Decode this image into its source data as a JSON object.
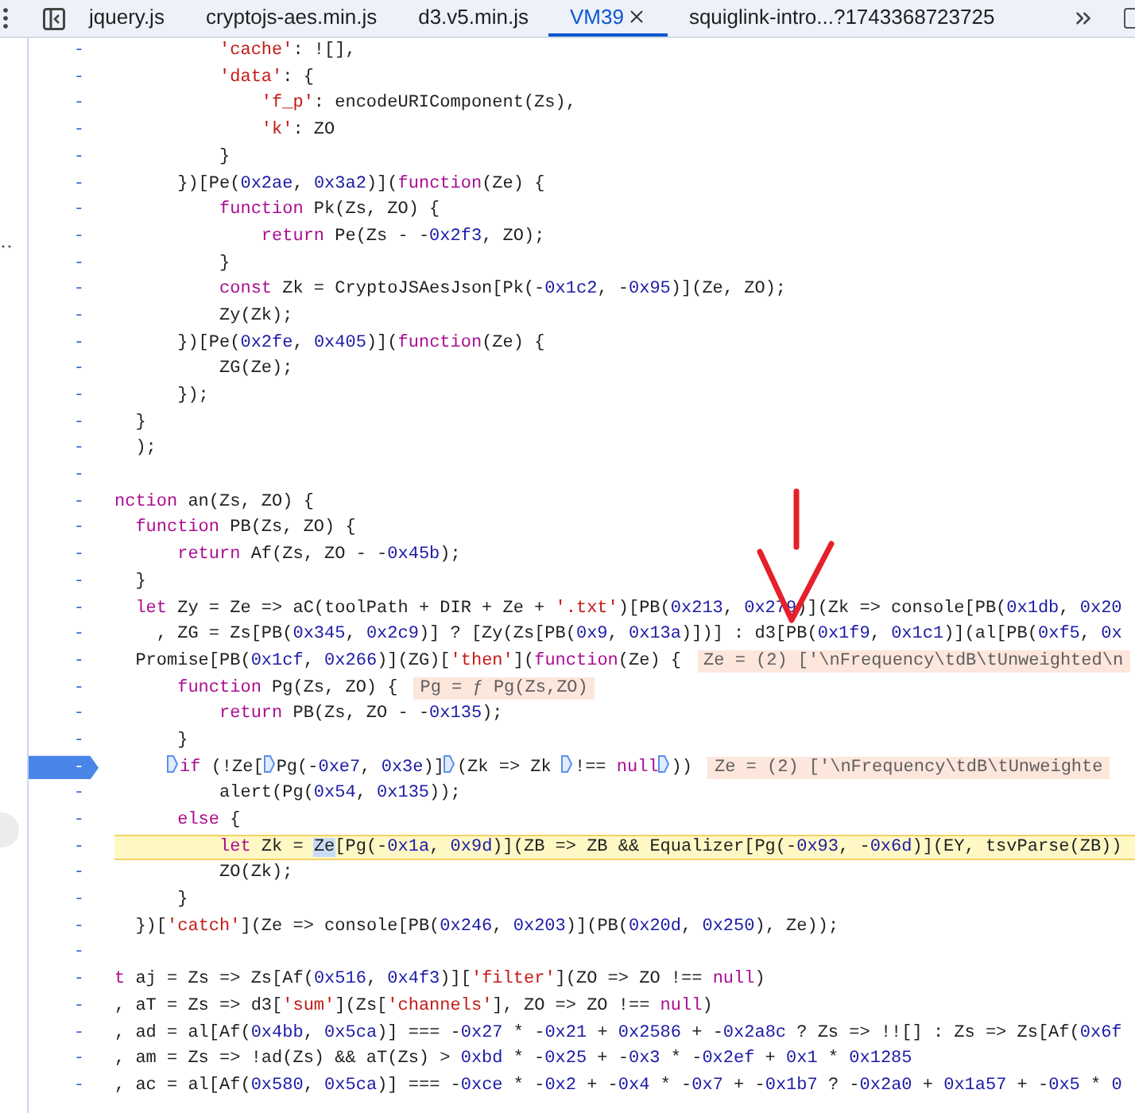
{
  "tabs": [
    {
      "label": "jquery.js",
      "selected": false,
      "closable": false
    },
    {
      "label": "cryptojs-aes.min.js",
      "selected": false,
      "closable": false
    },
    {
      "label": "d3.v5.min.js",
      "selected": false,
      "closable": false
    },
    {
      "label": "VM39",
      "selected": true,
      "closable": true
    },
    {
      "label": "squiglink-intro...?1743368723725",
      "selected": false,
      "closable": false
    }
  ],
  "lines": [
    {
      "gutter": "-",
      "breakpoint": false,
      "paused": false,
      "tokens": [
        {
          "kind": "str",
          "text": "          'cache'"
        },
        {
          "kind": "p",
          "text": ": ![],"
        }
      ]
    },
    {
      "gutter": "-",
      "breakpoint": false,
      "paused": false,
      "tokens": [
        {
          "kind": "str",
          "text": "          'data'"
        },
        {
          "kind": "p",
          "text": ": {"
        }
      ]
    },
    {
      "gutter": "-",
      "breakpoint": false,
      "paused": false,
      "tokens": [
        {
          "kind": "str",
          "text": "              'f_p'"
        },
        {
          "kind": "p",
          "text": ": encodeURIComponent(Zs),"
        }
      ]
    },
    {
      "gutter": "-",
      "breakpoint": false,
      "paused": false,
      "tokens": [
        {
          "kind": "str",
          "text": "              'k'"
        },
        {
          "kind": "p",
          "text": ": ZO"
        }
      ]
    },
    {
      "gutter": "-",
      "breakpoint": false,
      "paused": false,
      "tokens": [
        {
          "kind": "p",
          "text": "          }"
        }
      ]
    },
    {
      "gutter": "-",
      "breakpoint": false,
      "paused": false,
      "tokens": [
        {
          "kind": "p",
          "text": "      })[Pe("
        },
        {
          "kind": "num",
          "text": "0x2ae"
        },
        {
          "kind": "p",
          "text": ", "
        },
        {
          "kind": "num",
          "text": "0x3a2"
        },
        {
          "kind": "p",
          "text": ")]("
        },
        {
          "kind": "kw",
          "text": "function"
        },
        {
          "kind": "p",
          "text": "(Ze) {"
        }
      ]
    },
    {
      "gutter": "-",
      "breakpoint": false,
      "paused": false,
      "tokens": [
        {
          "kind": "kw",
          "text": "          function"
        },
        {
          "kind": "p",
          "text": " Pk(Zs, ZO) {"
        }
      ]
    },
    {
      "gutter": "-",
      "breakpoint": false,
      "paused": false,
      "tokens": [
        {
          "kind": "kw",
          "text": "              return"
        },
        {
          "kind": "p",
          "text": " Pe(Zs - -"
        },
        {
          "kind": "num",
          "text": "0x2f3"
        },
        {
          "kind": "p",
          "text": ", ZO);"
        }
      ]
    },
    {
      "gutter": "-",
      "breakpoint": false,
      "paused": false,
      "tokens": [
        {
          "kind": "p",
          "text": "          }"
        }
      ]
    },
    {
      "gutter": "-",
      "breakpoint": false,
      "paused": false,
      "tokens": [
        {
          "kind": "kw",
          "text": "          const"
        },
        {
          "kind": "p",
          "text": " Zk = CryptoJSAesJson[Pk(-"
        },
        {
          "kind": "num",
          "text": "0x1c2"
        },
        {
          "kind": "p",
          "text": ", -"
        },
        {
          "kind": "num",
          "text": "0x95"
        },
        {
          "kind": "p",
          "text": ")](Ze, ZO);"
        }
      ]
    },
    {
      "gutter": "-",
      "breakpoint": false,
      "paused": false,
      "tokens": [
        {
          "kind": "p",
          "text": "          Zy(Zk);"
        }
      ]
    },
    {
      "gutter": "-",
      "breakpoint": false,
      "paused": false,
      "tokens": [
        {
          "kind": "p",
          "text": "      })[Pe("
        },
        {
          "kind": "num",
          "text": "0x2fe"
        },
        {
          "kind": "p",
          "text": ", "
        },
        {
          "kind": "num",
          "text": "0x405"
        },
        {
          "kind": "p",
          "text": ")]("
        },
        {
          "kind": "kw",
          "text": "function"
        },
        {
          "kind": "p",
          "text": "(Ze) {"
        }
      ]
    },
    {
      "gutter": "-",
      "breakpoint": false,
      "paused": false,
      "tokens": [
        {
          "kind": "p",
          "text": "          ZG(Ze);"
        }
      ]
    },
    {
      "gutter": "-",
      "breakpoint": false,
      "paused": false,
      "tokens": [
        {
          "kind": "p",
          "text": "      });"
        }
      ]
    },
    {
      "gutter": "-",
      "breakpoint": false,
      "paused": false,
      "tokens": [
        {
          "kind": "p",
          "text": "  }"
        }
      ]
    },
    {
      "gutter": "-",
      "breakpoint": false,
      "paused": false,
      "tokens": [
        {
          "kind": "p",
          "text": "  );"
        }
      ]
    },
    {
      "gutter": "-",
      "breakpoint": false,
      "paused": false
    },
    {
      "gutter": "-",
      "breakpoint": false,
      "paused": false,
      "tokens": [
        {
          "kind": "kw",
          "text": "nction"
        },
        {
          "kind": "p",
          "text": " an(Zs, ZO) {"
        }
      ]
    },
    {
      "gutter": "-",
      "breakpoint": false,
      "paused": false,
      "tokens": [
        {
          "kind": "kw",
          "text": "  function"
        },
        {
          "kind": "p",
          "text": " PB(Zs, ZO) {"
        }
      ]
    },
    {
      "gutter": "-",
      "breakpoint": false,
      "paused": false,
      "tokens": [
        {
          "kind": "kw",
          "text": "      return"
        },
        {
          "kind": "p",
          "text": " Af(Zs, ZO - -"
        },
        {
          "kind": "num",
          "text": "0x45b"
        },
        {
          "kind": "p",
          "text": ");"
        }
      ]
    },
    {
      "gutter": "-",
      "breakpoint": false,
      "paused": false,
      "tokens": [
        {
          "kind": "p",
          "text": "  }"
        }
      ]
    },
    {
      "gutter": "-",
      "breakpoint": false,
      "paused": false,
      "tokens": [
        {
          "kind": "kw",
          "text": "  let"
        },
        {
          "kind": "p",
          "text": " Zy = Ze => aC(toolPath + DIR + Ze + "
        },
        {
          "kind": "str",
          "text": "'.txt'"
        },
        {
          "kind": "p",
          "text": ")[PB("
        },
        {
          "kind": "num",
          "text": "0x213"
        },
        {
          "kind": "p",
          "text": ", "
        },
        {
          "kind": "num",
          "text": "0x279"
        },
        {
          "kind": "p",
          "text": ")](Zk => console[PB("
        },
        {
          "kind": "num",
          "text": "0x1db"
        },
        {
          "kind": "p",
          "text": ", "
        },
        {
          "kind": "num",
          "text": "0x20"
        }
      ]
    },
    {
      "gutter": "-",
      "breakpoint": false,
      "paused": false,
      "tokens": [
        {
          "kind": "p",
          "text": "    , ZG = Zs[PB("
        },
        {
          "kind": "num",
          "text": "0x345"
        },
        {
          "kind": "p",
          "text": ", "
        },
        {
          "kind": "num",
          "text": "0x2c9"
        },
        {
          "kind": "p",
          "text": ")] ? [Zy(Zs[PB("
        },
        {
          "kind": "num",
          "text": "0x9"
        },
        {
          "kind": "p",
          "text": ", "
        },
        {
          "kind": "num",
          "text": "0x13a"
        },
        {
          "kind": "p",
          "text": ")])] : d3[PB("
        },
        {
          "kind": "num",
          "text": "0x1f9"
        },
        {
          "kind": "p",
          "text": ", "
        },
        {
          "kind": "num",
          "text": "0x1c1"
        },
        {
          "kind": "p",
          "text": ")](al[PB("
        },
        {
          "kind": "num",
          "text": "0xf5"
        },
        {
          "kind": "p",
          "text": ", "
        },
        {
          "kind": "num",
          "text": "0x"
        }
      ]
    },
    {
      "gutter": "-",
      "breakpoint": false,
      "paused": false,
      "hint": "Ze = (2) ['\\nFrequency\\tdB\\tUnweighted\\n",
      "tokens": [
        {
          "kind": "p",
          "text": "  Promise[PB("
        },
        {
          "kind": "num",
          "text": "0x1cf"
        },
        {
          "kind": "p",
          "text": ", "
        },
        {
          "kind": "num",
          "text": "0x266"
        },
        {
          "kind": "p",
          "text": ")](ZG)["
        },
        {
          "kind": "str",
          "text": "'then'"
        },
        {
          "kind": "p",
          "text": "]("
        },
        {
          "kind": "kw",
          "text": "function"
        },
        {
          "kind": "p",
          "text": "(Ze) {"
        }
      ]
    },
    {
      "gutter": "-",
      "breakpoint": false,
      "paused": false,
      "hint": "Pg = ƒ Pg(Zs,ZO)",
      "tokens": [
        {
          "kind": "kw",
          "text": "      function"
        },
        {
          "kind": "p",
          "text": " Pg(Zs, ZO) {"
        }
      ]
    },
    {
      "gutter": "-",
      "breakpoint": false,
      "paused": false,
      "tokens": [
        {
          "kind": "kw",
          "text": "          return"
        },
        {
          "kind": "p",
          "text": " PB(Zs, ZO - -"
        },
        {
          "kind": "num",
          "text": "0x135"
        },
        {
          "kind": "p",
          "text": ");"
        }
      ]
    },
    {
      "gutter": "-",
      "breakpoint": false,
      "paused": false,
      "tokens": [
        {
          "kind": "p",
          "text": "      }"
        }
      ]
    },
    {
      "gutter": "-",
      "breakpoint": true,
      "paused": false,
      "hint": "Ze = (2) ['\\nFrequency\\tdB\\tUnweighte",
      "tokens": [
        {
          "kind": "stop"
        },
        {
          "kind": "kw",
          "text": "if"
        },
        {
          "kind": "p",
          "text": " (!Ze["
        },
        {
          "kind": "stop"
        },
        {
          "kind": "p",
          "text": "Pg(-"
        },
        {
          "kind": "num",
          "text": "0xe7"
        },
        {
          "kind": "p",
          "text": ", "
        },
        {
          "kind": "num",
          "text": "0x3e"
        },
        {
          "kind": "p",
          "text": ")]"
        },
        {
          "kind": "stop"
        },
        {
          "kind": "p",
          "text": "(Zk => Zk "
        },
        {
          "kind": "stop"
        },
        {
          "kind": "p",
          "text": "!== "
        },
        {
          "kind": "kw",
          "text": "null"
        },
        {
          "kind": "stop"
        },
        {
          "kind": "p",
          "text": "))"
        }
      ]
    },
    {
      "gutter": "-",
      "breakpoint": false,
      "paused": false,
      "tokens": [
        {
          "kind": "p",
          "text": "          alert(Pg("
        },
        {
          "kind": "num",
          "text": "0x54"
        },
        {
          "kind": "p",
          "text": ", "
        },
        {
          "kind": "num",
          "text": "0x135"
        },
        {
          "kind": "p",
          "text": "));"
        }
      ]
    },
    {
      "gutter": "-",
      "breakpoint": false,
      "paused": false,
      "tokens": [
        {
          "kind": "kw",
          "text": "      else"
        },
        {
          "kind": "p",
          "text": " {"
        }
      ]
    },
    {
      "gutter": "-",
      "breakpoint": false,
      "paused": true,
      "tokens": [
        {
          "kind": "kw",
          "text": "          let"
        },
        {
          "kind": "p",
          "text": " Zk = "
        },
        {
          "kind": "sel",
          "text": "Ze"
        },
        {
          "kind": "p",
          "text": "[Pg(-"
        },
        {
          "kind": "num",
          "text": "0x1a"
        },
        {
          "kind": "p",
          "text": ", "
        },
        {
          "kind": "num",
          "text": "0x9d"
        },
        {
          "kind": "p",
          "text": ")](ZB => ZB && Equalizer[Pg(-"
        },
        {
          "kind": "num",
          "text": "0x93"
        },
        {
          "kind": "p",
          "text": ", -"
        },
        {
          "kind": "num",
          "text": "0x6d"
        },
        {
          "kind": "p",
          "text": ")](EY, tsvParse(ZB))"
        }
      ]
    },
    {
      "gutter": "-",
      "breakpoint": false,
      "paused": false,
      "tokens": [
        {
          "kind": "p",
          "text": "          ZO(Zk);"
        }
      ]
    },
    {
      "gutter": "-",
      "breakpoint": false,
      "paused": false,
      "tokens": [
        {
          "kind": "p",
          "text": "      }"
        }
      ]
    },
    {
      "gutter": "-",
      "breakpoint": false,
      "paused": false,
      "tokens": [
        {
          "kind": "p",
          "text": "  })["
        },
        {
          "kind": "str",
          "text": "'catch'"
        },
        {
          "kind": "p",
          "text": "](Ze => console[PB("
        },
        {
          "kind": "num",
          "text": "0x246"
        },
        {
          "kind": "p",
          "text": ", "
        },
        {
          "kind": "num",
          "text": "0x203"
        },
        {
          "kind": "p",
          "text": ")](PB("
        },
        {
          "kind": "num",
          "text": "0x20d"
        },
        {
          "kind": "p",
          "text": ", "
        },
        {
          "kind": "num",
          "text": "0x250"
        },
        {
          "kind": "p",
          "text": "), Ze));"
        }
      ]
    },
    {
      "gutter": "-",
      "breakpoint": false,
      "paused": false
    },
    {
      "gutter": "-",
      "breakpoint": false,
      "paused": false,
      "tokens": [
        {
          "kind": "kw",
          "text": "t"
        },
        {
          "kind": "p",
          "text": " aj = Zs => Zs[Af("
        },
        {
          "kind": "num",
          "text": "0x516"
        },
        {
          "kind": "p",
          "text": ", "
        },
        {
          "kind": "num",
          "text": "0x4f3"
        },
        {
          "kind": "p",
          "text": ")]["
        },
        {
          "kind": "str",
          "text": "'filter'"
        },
        {
          "kind": "p",
          "text": "](ZO => ZO !== "
        },
        {
          "kind": "kw",
          "text": "null"
        },
        {
          "kind": "p",
          "text": ")"
        }
      ]
    },
    {
      "gutter": "-",
      "breakpoint": false,
      "paused": false,
      "tokens": [
        {
          "kind": "p",
          "text": ", aT = Zs => d3["
        },
        {
          "kind": "str",
          "text": "'sum'"
        },
        {
          "kind": "p",
          "text": "](Zs["
        },
        {
          "kind": "str",
          "text": "'channels'"
        },
        {
          "kind": "p",
          "text": "], ZO => ZO !== "
        },
        {
          "kind": "kw",
          "text": "null"
        },
        {
          "kind": "p",
          "text": ")"
        }
      ]
    },
    {
      "gutter": "-",
      "breakpoint": false,
      "paused": false,
      "tokens": [
        {
          "kind": "p",
          "text": ", ad = al[Af("
        },
        {
          "kind": "num",
          "text": "0x4bb"
        },
        {
          "kind": "p",
          "text": ", "
        },
        {
          "kind": "num",
          "text": "0x5ca"
        },
        {
          "kind": "p",
          "text": ")] === -"
        },
        {
          "kind": "num",
          "text": "0x27"
        },
        {
          "kind": "p",
          "text": " * -"
        },
        {
          "kind": "num",
          "text": "0x21"
        },
        {
          "kind": "p",
          "text": " + "
        },
        {
          "kind": "num",
          "text": "0x2586"
        },
        {
          "kind": "p",
          "text": " + -"
        },
        {
          "kind": "num",
          "text": "0x2a8c"
        },
        {
          "kind": "p",
          "text": " ? Zs => !![] : Zs => Zs[Af("
        },
        {
          "kind": "num",
          "text": "0x6f"
        }
      ]
    },
    {
      "gutter": "-",
      "breakpoint": false,
      "paused": false,
      "tokens": [
        {
          "kind": "p",
          "text": ", am = Zs => !ad(Zs) && aT(Zs) > "
        },
        {
          "kind": "num",
          "text": "0xbd"
        },
        {
          "kind": "p",
          "text": " * -"
        },
        {
          "kind": "num",
          "text": "0x25"
        },
        {
          "kind": "p",
          "text": " + -"
        },
        {
          "kind": "num",
          "text": "0x3"
        },
        {
          "kind": "p",
          "text": " * -"
        },
        {
          "kind": "num",
          "text": "0x2ef"
        },
        {
          "kind": "p",
          "text": " + "
        },
        {
          "kind": "num",
          "text": "0x1"
        },
        {
          "kind": "p",
          "text": " * "
        },
        {
          "kind": "num",
          "text": "0x1285"
        }
      ]
    },
    {
      "gutter": "-",
      "breakpoint": false,
      "paused": false,
      "tokens": [
        {
          "kind": "p",
          "text": ", ac = al[Af("
        },
        {
          "kind": "num",
          "text": "0x580"
        },
        {
          "kind": "p",
          "text": ", "
        },
        {
          "kind": "num",
          "text": "0x5ca"
        },
        {
          "kind": "p",
          "text": ")] === -"
        },
        {
          "kind": "num",
          "text": "0xce"
        },
        {
          "kind": "p",
          "text": " * -"
        },
        {
          "kind": "num",
          "text": "0x2"
        },
        {
          "kind": "p",
          "text": " + -"
        },
        {
          "kind": "num",
          "text": "0x4"
        },
        {
          "kind": "p",
          "text": " * -"
        },
        {
          "kind": "num",
          "text": "0x7"
        },
        {
          "kind": "p",
          "text": " + -"
        },
        {
          "kind": "num",
          "text": "0x1b7"
        },
        {
          "kind": "p",
          "text": " ? -"
        },
        {
          "kind": "num",
          "text": "0x2a0"
        },
        {
          "kind": "p",
          "text": " + "
        },
        {
          "kind": "num",
          "text": "0x1a57"
        },
        {
          "kind": "p",
          "text": " + -"
        },
        {
          "kind": "num",
          "text": "0x5"
        },
        {
          "kind": "p",
          "text": " * "
        },
        {
          "kind": "num",
          "text": "0"
        }
      ]
    }
  ]
}
